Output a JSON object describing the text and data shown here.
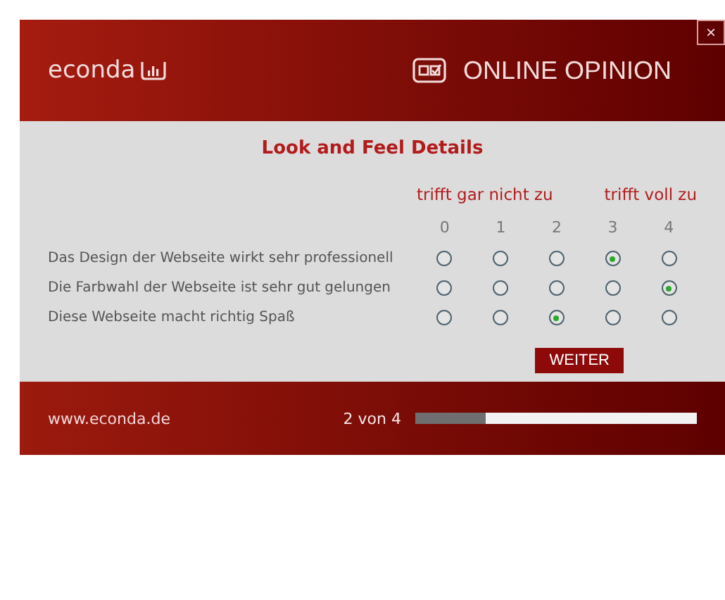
{
  "header": {
    "logo": "econda",
    "title": "ONLINE OPINION",
    "close": "×"
  },
  "heading": "Look and Feel Details",
  "scale": {
    "low_label": "trifft gar nicht zu",
    "high_label": "trifft voll zu",
    "points": [
      "0",
      "1",
      "2",
      "3",
      "4"
    ]
  },
  "questions": [
    {
      "text": "Das Design der Webseite wirkt sehr professionell",
      "options": [
        {
          "selected": false
        },
        {
          "selected": false
        },
        {
          "selected": false
        },
        {
          "selected": true
        },
        {
          "selected": false
        }
      ]
    },
    {
      "text": "Die Farbwahl der Webseite ist sehr gut gelungen",
      "options": [
        {
          "selected": false
        },
        {
          "selected": false
        },
        {
          "selected": false
        },
        {
          "selected": false
        },
        {
          "selected": true
        }
      ]
    },
    {
      "text": "Diese Webseite macht richtig Spaß",
      "options": [
        {
          "selected": false
        },
        {
          "selected": false
        },
        {
          "selected": true
        },
        {
          "selected": false
        },
        {
          "selected": false
        }
      ]
    }
  ],
  "next_button": "WEITER",
  "footer": {
    "url": "www.econda.de",
    "progress_text": "2 von 4",
    "level": 0.25
  }
}
